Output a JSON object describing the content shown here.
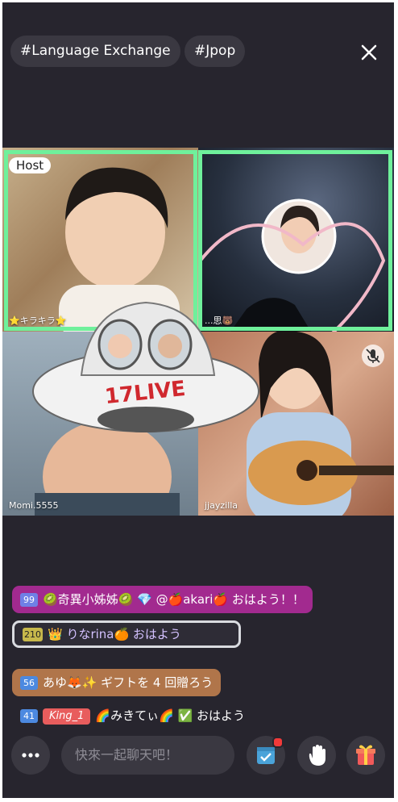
{
  "header": {
    "tags": [
      "#Language Exchange",
      "#Jpop"
    ]
  },
  "tiles": [
    {
      "name": "⭐キラキラ⭐",
      "role": "Host",
      "active": true
    },
    {
      "name": "...思🐻",
      "role": "",
      "active": true
    },
    {
      "name": "Momi.5555",
      "role": "",
      "active": false
    },
    {
      "name": "jjayzilla",
      "role": "",
      "active": false,
      "muted": true
    }
  ],
  "sticker": {
    "brand": "17LIVE"
  },
  "chat": [
    {
      "level": "99",
      "text": "🥝奇異小姊姊🥝 💎 @🍎akari🍎 おはよう！！",
      "bg": "#a22a8f"
    },
    {
      "level": "210",
      "text": "👑 りなrina🍊 おはよう",
      "bg": "#2e2c36"
    },
    {
      "level": "56",
      "text": "あゆ🦊✨ ギフトを 4 回贈ろう",
      "bg": "#b0754a"
    },
    {
      "level": "41",
      "badge": "King_1",
      "text": "🌈みきてぃ🌈 ✅ おはよう",
      "bg": "transparent"
    }
  ],
  "composer": {
    "placeholder": "快來一起聊天吧！"
  },
  "colors": {
    "accent": "#6ff09b",
    "background": "#27252e"
  }
}
